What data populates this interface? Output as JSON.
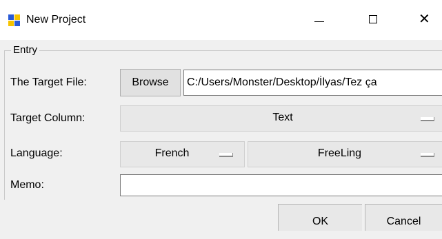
{
  "window": {
    "title": "New Project",
    "icon_name": "app-grid-icon",
    "icon_colors": [
      "#2a5bd7",
      "#f6c400",
      "#f6c400",
      "#2a5bd7"
    ],
    "minimize_glyph": "",
    "maximize_glyph": "",
    "close_glyph": "✕"
  },
  "entry": {
    "legend": "Entry",
    "target_file": {
      "label": "The Target File:",
      "browse_label": "Browse",
      "value": "C:/Users/Monster/Desktop/İlyas/Tez ça"
    },
    "target_column": {
      "label": "Target Column:",
      "value": "Text"
    },
    "language": {
      "label": "Language:",
      "value": "French",
      "tool_value": "FreeLing"
    },
    "memo": {
      "label": "Memo:",
      "value": ""
    }
  },
  "footer": {
    "ok_label": "OK",
    "cancel_label": "Cancel"
  }
}
